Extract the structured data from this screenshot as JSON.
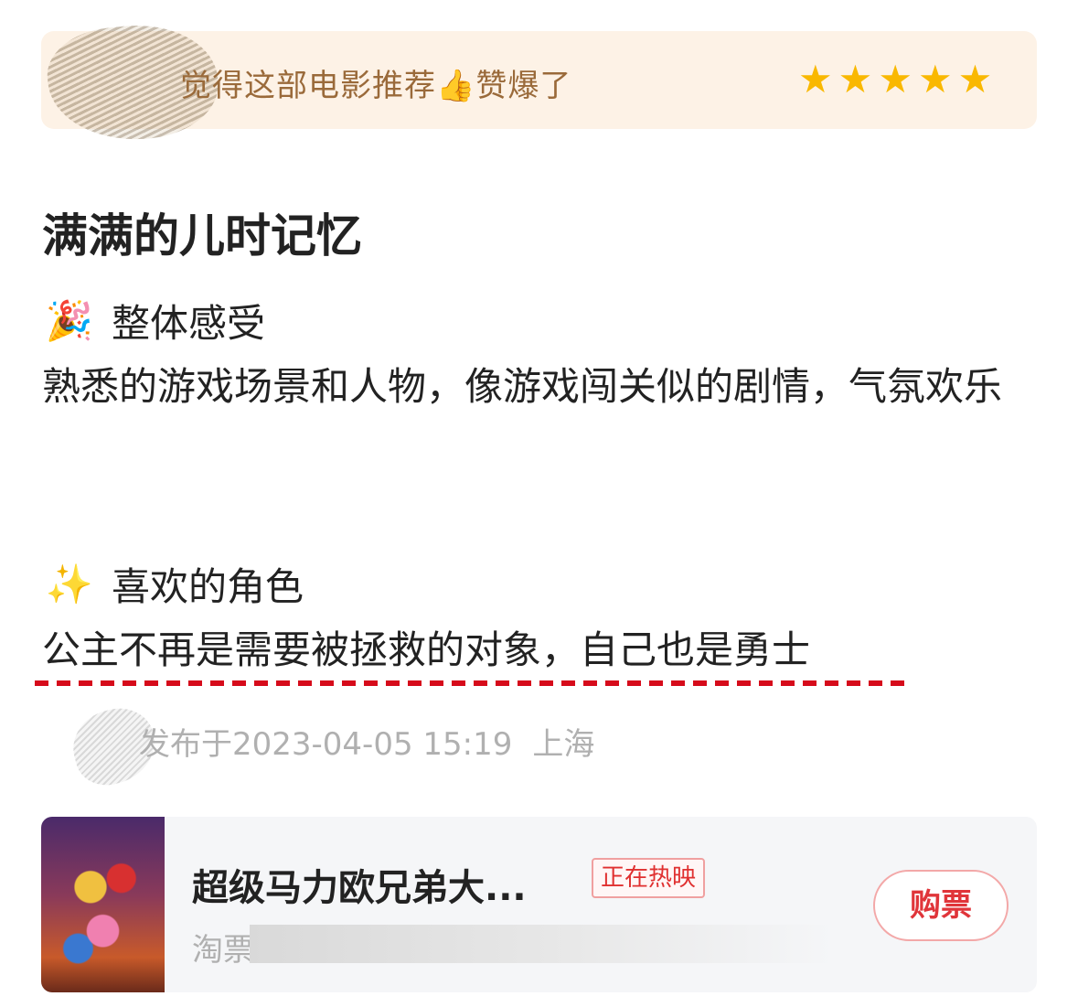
{
  "rating": {
    "text": "觉得这部电影推荐👍赞爆了",
    "stars": [
      "★",
      "★",
      "★",
      "★",
      "★"
    ],
    "star_color": "#f9b800",
    "banner_bg": "#fdf2e6"
  },
  "review": {
    "title": "满满的儿时记忆",
    "sections": [
      {
        "emoji": "🎉",
        "heading": "整体感受",
        "body": "熟悉的游戏场景和人物，像游戏闯关似的剧情，气氛欢乐"
      },
      {
        "emoji": "✨",
        "heading": "喜欢的角色",
        "body": "公主不再是需要被拯救的对象，自己也是勇士"
      }
    ],
    "underline_color": "#d60b1b"
  },
  "meta": {
    "published": "发布于2023-04-05 15:19",
    "location": "上海"
  },
  "movie": {
    "title": "超级马力欧兄弟大...",
    "status_badge": "正在热映",
    "source": "淘票",
    "buy_label": "购票",
    "accent": "#e0353a"
  }
}
